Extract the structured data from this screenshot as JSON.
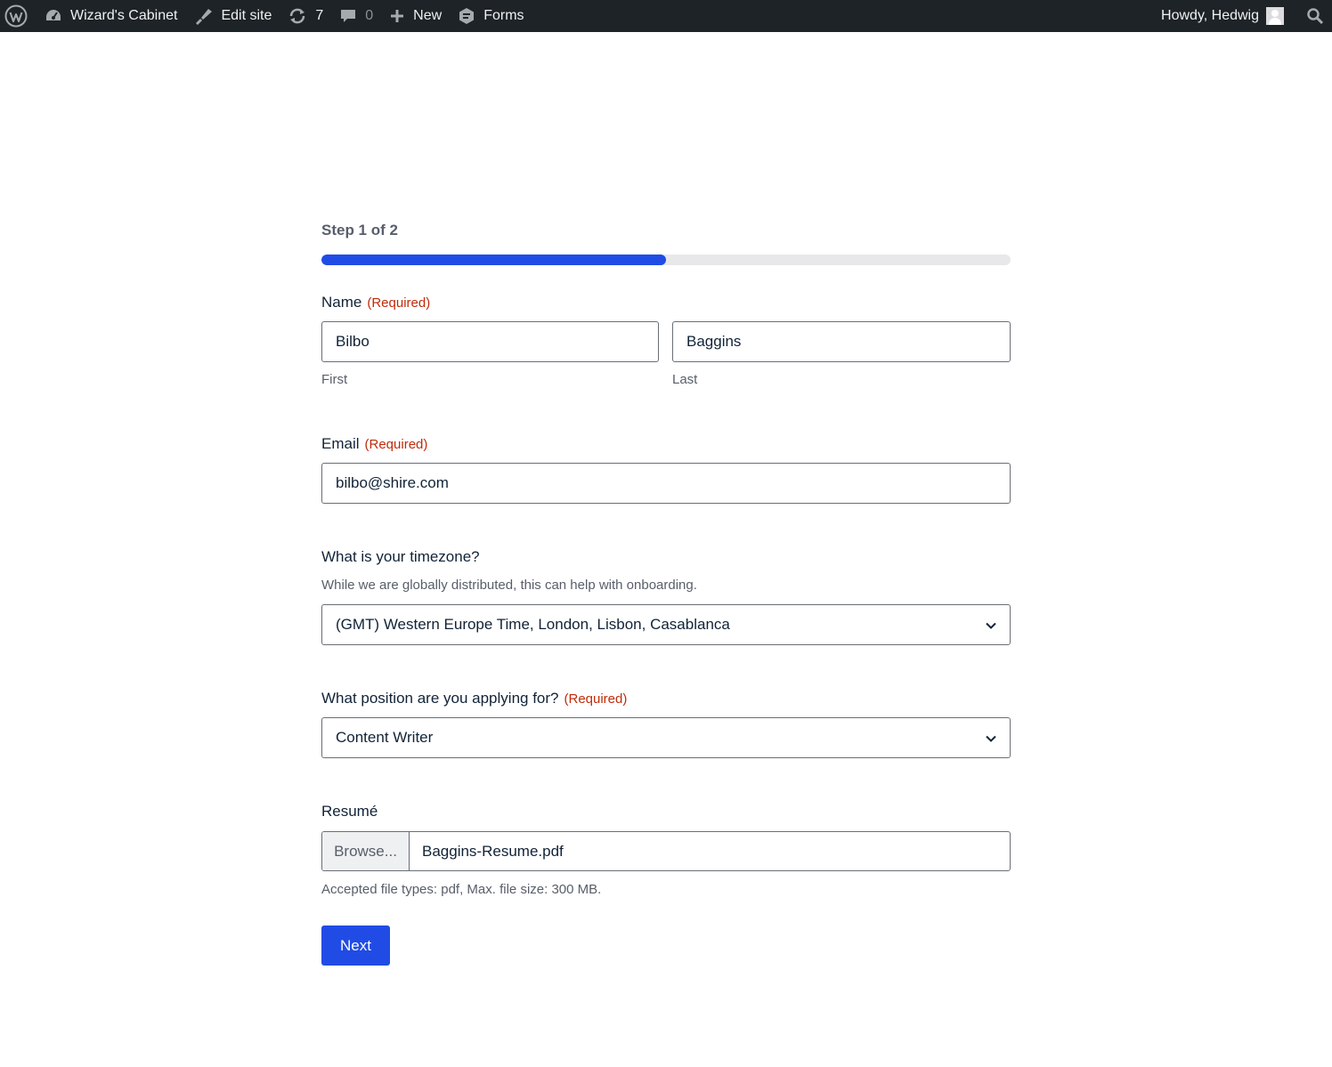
{
  "adminbar": {
    "site_name": "Wizard's Cabinet",
    "edit_site": "Edit site",
    "updates_count": "7",
    "comments_count": "0",
    "new_label": "New",
    "forms_label": "Forms",
    "howdy": "Howdy, Hedwig",
    "icons": [
      "wordpress-logo-icon",
      "dashboard-icon",
      "edit-brush-icon",
      "updates-icon",
      "comment-icon",
      "plus-icon",
      "forms-icon",
      "avatar",
      "search-icon"
    ]
  },
  "form": {
    "step": "Step 1 of 2",
    "progress_fraction": 0.5,
    "name": {
      "label": "Name",
      "required": "(Required)",
      "first_value": "Bilbo",
      "last_value": "Baggins",
      "first_sub": "First",
      "last_sub": "Last"
    },
    "email": {
      "label": "Email",
      "required": "(Required)",
      "value": "bilbo@shire.com"
    },
    "timezone": {
      "label": "What is your timezone?",
      "description": "While we are globally distributed, this can help with onboarding.",
      "selected": "(GMT) Western Europe Time, London, Lisbon, Casablanca"
    },
    "position": {
      "label": "What position are you applying for?",
      "required": "(Required)",
      "selected": "Content Writer"
    },
    "resume": {
      "label": "Resumé",
      "browse": "Browse...",
      "filename": "Baggins-Resume.pdf",
      "note": "Accepted file types: pdf, Max. file size: 300 MB."
    },
    "next_label": "Next"
  },
  "colors": {
    "adminbar_bg": "#1d2327",
    "accent": "#204ce5",
    "required": "#c02b0a",
    "progress_track": "#e8e8ea"
  }
}
